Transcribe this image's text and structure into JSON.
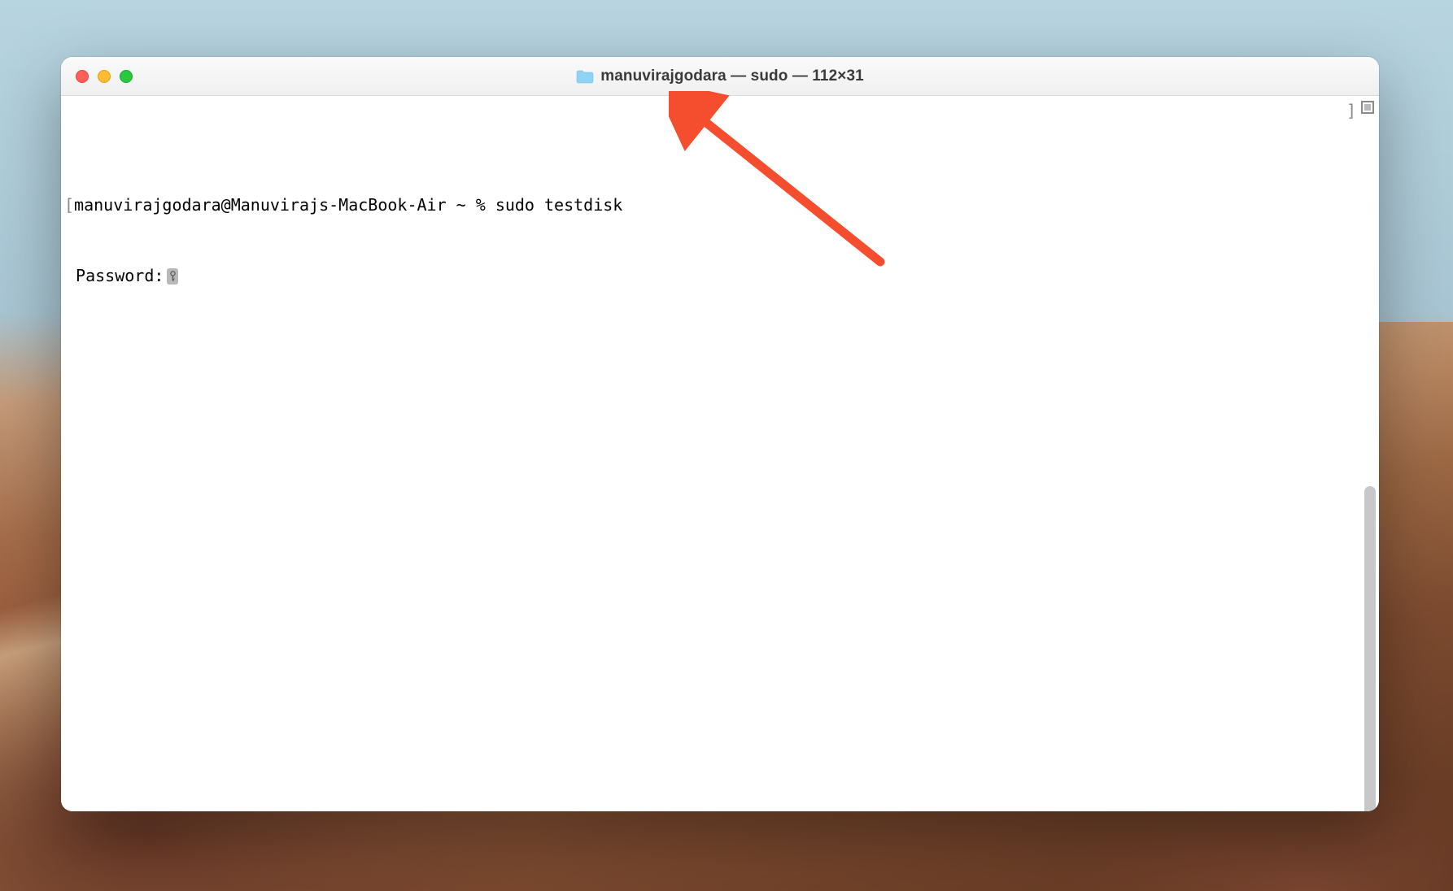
{
  "window": {
    "title": "manuvirajgodara — sudo — 112×31"
  },
  "terminal": {
    "prompt_open_bracket": "[",
    "prompt_close_bracket": "]",
    "prompt": "manuvirajgodara@Manuvirajs-MacBook-Air ~ % ",
    "command": "sudo testdisk",
    "password_label": "Password:"
  },
  "colors": {
    "traffic_close": "#ff5f57",
    "traffic_min": "#febc2e",
    "traffic_max": "#28c840",
    "arrow": "#f44e2e"
  }
}
